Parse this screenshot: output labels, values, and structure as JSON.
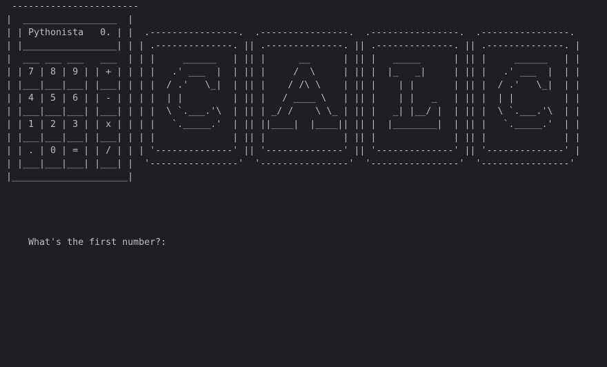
{
  "console": {
    "ascii_banner": [
      " -----------------------",
      "|  _________________  |",
      "| | Pythonista   0. | |  .----------------.  .----------------.  .----------------.  .----------------.",
      "| |_________________| | | .--------------. || .--------------. || .--------------. || .--------------. |",
      "|  ___ ___ ___   ___  | | |     ______   | || |      __      | || |   _____      | || |     ______   | |",
      "| | 7 | 8 | 9 | | + | | | |   .' ___  |  | || |     /  \\     | || |  |_   _|     | || |   .' ___  |  | |",
      "| |___|___|___| |___| | | |  / .'   \\_|  | || |    / /\\ \\    | || |    | |       | || |  / .'   \\_|  | |",
      "| | 4 | 5 | 6 | | - | | | |  | |         | || |   / ____ \\   | || |    | |   _   | || |  | |         | |",
      "| |___|___|___| |___| | | |  \\ `.___.'\\  | || | _/ /    \\ \\_ | || |   _| |__/ |  | || |  \\ `.___.'\\  | |",
      "| | 1 | 2 | 3 | | x | | | |   `._____.'  | || ||____|  |____|| || |  |________|  | || |   `._____.'  | |",
      "| |___|___|___| |___| | | |              | || |              | || |              | || |              | |",
      "| | . | 0 | = | | / | | | '--------------' || '--------------' || '--------------' || '--------------' |",
      "| |___|___|___| |___| |  '----------------'  '----------------'  '----------------'  '----------------'",
      "|_____________________|"
    ],
    "prompt": "What's the first number?:"
  }
}
